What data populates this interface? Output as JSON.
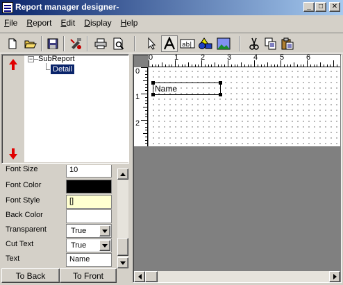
{
  "window": {
    "title": "Report manager designer-",
    "minimize": "_",
    "maximize": "□",
    "close": "✕"
  },
  "menu": [
    {
      "label": "File",
      "accel": "F",
      "rest": "ile"
    },
    {
      "label": "Report",
      "accel": "R",
      "rest": "eport"
    },
    {
      "label": "Edit",
      "accel": "E",
      "rest": "dit"
    },
    {
      "label": "Display",
      "accel": "D",
      "rest": "isplay"
    },
    {
      "label": "Help",
      "accel": "H",
      "rest": "elp"
    }
  ],
  "toolbar": {
    "icons": [
      "new-icon",
      "open-icon",
      "save-icon",
      "properties-icon",
      "print-icon",
      "print-preview-icon",
      "select-pointer-icon",
      "label-tool-icon",
      "expression-tool-icon",
      "shape-tool-icon",
      "image-tool-icon",
      "cut-icon",
      "copy-icon",
      "paste-icon"
    ]
  },
  "tree": {
    "root": "SubReport",
    "root_toggle": "−",
    "child": "Detail"
  },
  "properties": [
    {
      "label": "Font Size",
      "value": "10",
      "kind": "text"
    },
    {
      "label": "Font Color",
      "value": "",
      "kind": "color",
      "color": "#000000"
    },
    {
      "label": "Font Style",
      "value": "[]",
      "kind": "style"
    },
    {
      "label": "Back Color",
      "value": "",
      "kind": "color",
      "color": "#ffffff"
    },
    {
      "label": "Transparent",
      "value": "True",
      "kind": "combo"
    },
    {
      "label": "Cut Text",
      "value": "True",
      "kind": "combo"
    },
    {
      "label": "Text",
      "value": "Name",
      "kind": "text"
    }
  ],
  "buttons": {
    "to_back": "To Back",
    "to_front": "To Front"
  },
  "ruler": {
    "h_ticks": [
      "0",
      "1",
      "2",
      "3",
      "4",
      "5",
      "6"
    ],
    "v_ticks": [
      "0",
      "1",
      "2"
    ]
  },
  "canvas": {
    "label_text": "Name"
  },
  "colors": {
    "title_start": "#0a246a",
    "title_end": "#a6caf0",
    "arrow_red": "#e00000",
    "selected": "#0a246a"
  }
}
